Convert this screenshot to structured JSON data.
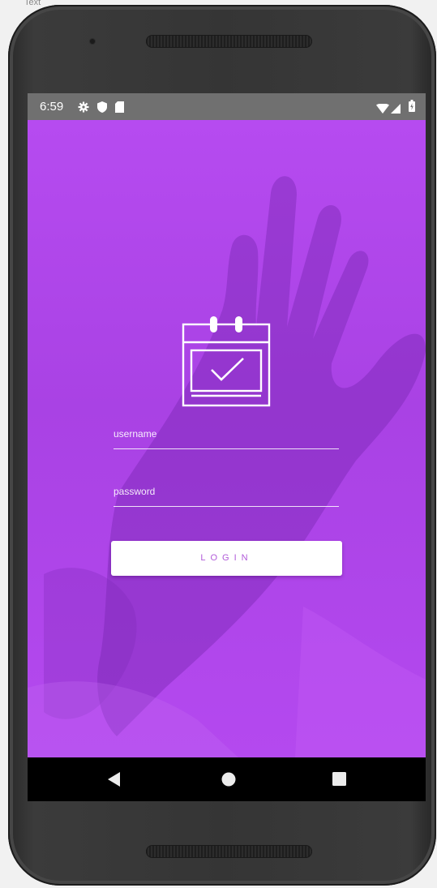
{
  "corner_text": "Text",
  "status_bar": {
    "time": "6:59",
    "left_icons": [
      "settings-icon",
      "shield-icon",
      "sd-card-icon"
    ],
    "right_icons": [
      "wifi-icon",
      "signal-icon",
      "battery-icon"
    ],
    "background": "#707070"
  },
  "app": {
    "logo_icon": "calendar-check-icon",
    "background_color": "#b04aea",
    "username": {
      "placeholder": "username",
      "value": ""
    },
    "password": {
      "placeholder": "password",
      "value": ""
    },
    "login_label": "LOGIN",
    "login_text_color": "#b15ad9"
  },
  "nav_bar": {
    "buttons": [
      "back-icon",
      "home-icon",
      "recents-icon"
    ]
  }
}
